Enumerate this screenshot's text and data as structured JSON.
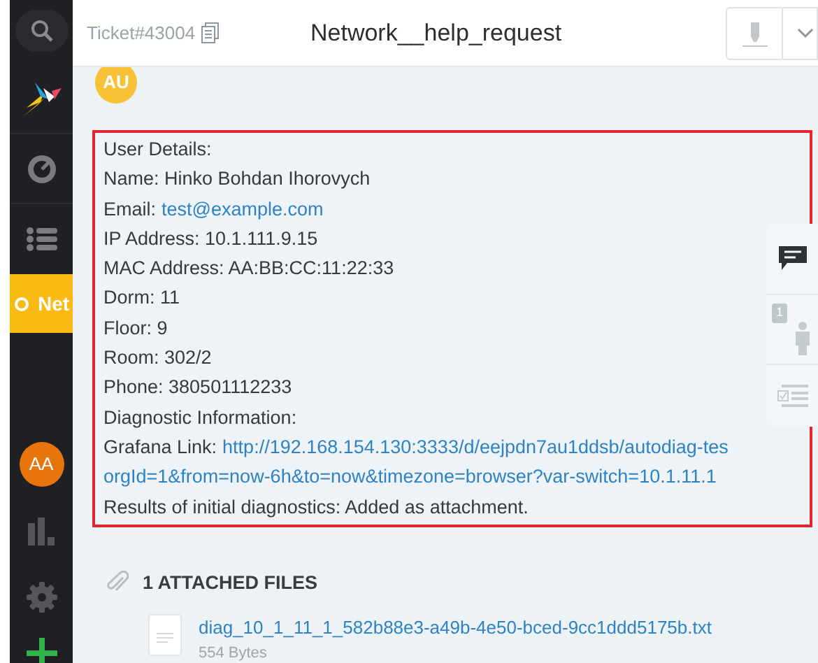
{
  "sidebar": {
    "items": [
      {
        "kind": "search"
      },
      {
        "kind": "logo"
      },
      {
        "kind": "gauge"
      },
      {
        "kind": "list"
      },
      {
        "kind": "tab",
        "label": "Net",
        "selected": true
      },
      {
        "kind": "spacer"
      },
      {
        "kind": "avatar",
        "label": "AA",
        "color": "#e8750c"
      },
      {
        "kind": "chart"
      },
      {
        "kind": "gear"
      },
      {
        "kind": "plus"
      }
    ]
  },
  "header": {
    "ticket": "Ticket#43004",
    "title": "Network__help_request"
  },
  "article": {
    "author_initials": "AU",
    "lines": [
      {
        "kind": "text",
        "text": "User Details:"
      },
      {
        "kind": "text",
        "text": "Name: Hinko Bohdan Ihorovych"
      },
      {
        "kind": "field",
        "label": "Email:",
        "link": "test@example.com"
      },
      {
        "kind": "text",
        "text": "IP Address: 10.1.111.9.15"
      },
      {
        "kind": "text",
        "text": "MAC Address: AA:BB:CC:11:22:33"
      },
      {
        "kind": "text",
        "text": "Dorm: 11"
      },
      {
        "kind": "text",
        "text": "Floor: 9"
      },
      {
        "kind": "text",
        "text": "Room: 302/2"
      },
      {
        "kind": "text",
        "text": "Phone: 380501112233"
      },
      {
        "kind": "text",
        "text": "Diagnostic Information:"
      },
      {
        "kind": "field",
        "label": "Grafana Link:",
        "link": "http://192.168.154.130:3333/d/eejpdn7au1ddsb/autodiag-tes"
      },
      {
        "kind": "link",
        "link": "orgId=1&from=now-6h&to=now&timezone=browser?var-switch=10.1.11.1"
      },
      {
        "kind": "text",
        "text": "Results of initial diagnostics: Added as attachment."
      }
    ]
  },
  "side_panel": {
    "badge": "1"
  },
  "attachments": {
    "heading": "1 ATTACHED FILES",
    "files": [
      {
        "name": "diag_10_1_11_1_582b88e3-a49b-4e50-bced-9cc1ddd5175b.txt",
        "size": "554 Bytes"
      }
    ]
  }
}
